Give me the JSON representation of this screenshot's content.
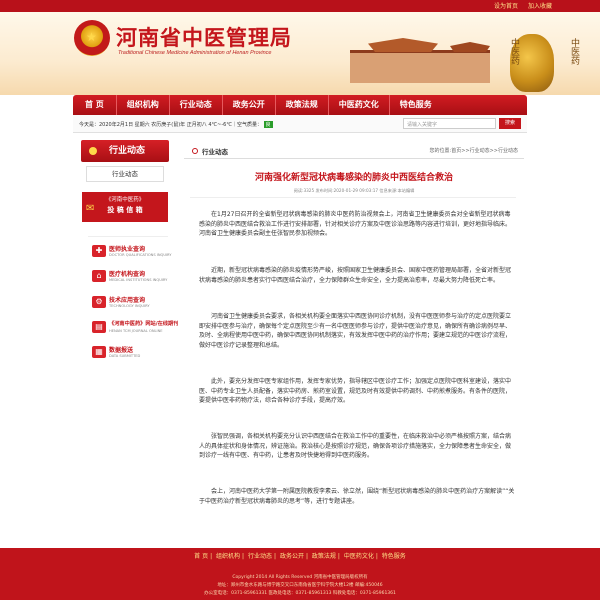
{
  "top_links": [
    "设为首页",
    "加入收藏"
  ],
  "header": {
    "title": "河南省中医管理局",
    "subtitle": "Traditional Chinese Medicine Administration of Henan Province",
    "calligraphy_left": "中医药",
    "calligraphy_right": "中医药"
  },
  "nav": [
    "首 页",
    "组织机构",
    "行业动态",
    "政务公开",
    "政策法规",
    "中医药文化",
    "特色服务"
  ],
  "infobar": {
    "date": "今天是：2020年2月1日 星期六 农历庚子(鼠)年 正月初八",
    "weather": "4℃~-6℃｜空气质量：",
    "aqi": "良",
    "search_placeholder": "请输入关键字",
    "search_button": "搜索"
  },
  "sidebar": {
    "heading": "行业动态",
    "current": "行业动态",
    "banner_top": "《河南中医药》",
    "banner_main": "投 稿 信 箱",
    "services": [
      {
        "title": "医师执业查询",
        "en": "DOCTOR QUALIFICATIONS INQUIRY",
        "icon": "doctor-icon"
      },
      {
        "title": "医疗机构查询",
        "en": "MEDICAL INSTITUTIONS INQUIRY",
        "icon": "hospital-icon"
      },
      {
        "title": "技术应用查询",
        "en": "TECHNOLOGY INQUIRY",
        "icon": "technology-icon"
      },
      {
        "title": "《河南中医药》网站/在线期刊",
        "en": "HENAN TCM JOURNAL ONLINE",
        "icon": "journal-icon"
      },
      {
        "title": "数据报送",
        "en": "DATA SUBMITTED",
        "icon": "data-icon"
      }
    ]
  },
  "main": {
    "section": "行业动态",
    "breadcrumb": "您的位置:首页>>行业动态>>行业动态",
    "title": "河南强化新型冠状病毒感染的肺炎中西医结合救治",
    "meta": "阅读:3325  发布时间:2020-01-29 09:03:17  信息来源:本站编辑",
    "paragraphs": [
      "在1月27日召开的全省新型冠状病毒感染的肺炎中医药防治视频会上，河南省卫生健康委员会对全省新型冠状病毒感染的肺炎中西医结合救治工作进行安排部署，针对相关诊疗方案及中医诊治思路等内容进行培训，更好地指导临床。河南省卫生健康委员会副主任张智民参加视频会。",
      "近期，新型冠状病毒感染的肺炎疫情形势严峻，按照国家卫生健康委员会、国家中医药管理局部署，全省对新型冠状病毒感染的肺炎患者实行中西医结合治疗，全力保障群众生命安全，全力提高治愈率，尽最大努力降低死亡率。",
      "河南省卫生健康委员会要求，各相关机构要全面落实中西医协同诊疗机制，没有中医医师参与治疗的定点医院要立即安排中医参与治疗，确保每个定点医院至少有一名中医医师参与诊疗，提供中医治疗意见，确保所有确诊病例尽早、及时、全病程使用中医中药，确保中西医协同机制落实，有效发挥中医中药的治疗作用；要建立规范的中医诊疗流程，做好中医诊疗记录整理和总结。",
      "此外，要充分发挥中医专家组作用，发挥专家优势，指导辖区中医诊疗工作；加强定点医院中医科室建设，落实中医、中药专业卫生人员配备，落实中药房、煎药室设置，规范及时有效提供中药调剂、中药煎煮服务。有条件的医院，要提供中医非药物疗法，综合各种诊疗手段，提高疗效。",
      "张智民强调，各相关机构要充分认识中西医结合在救治工作中的重要性，在临床救治中必须严格按照方案，结合病人的具体症状和身体情况，辨证施治。救治核心是按照诊疗规范，确保各项诊疗措施落实，全力保障患者生命安全，做到诊疗一线有中医、有中药，让患者及时快捷地得到中医药服务。",
      "会上，河南中医药大学第一附属医院教授李素云、徐立然，围绕“新型冠状病毒感染的肺炎中医药治疗方案解读”“关于中医药治疗新型冠状病毒肺炎的思考”等，进行专题讲座。"
    ]
  },
  "footer": {
    "links": [
      "首 页",
      "组织机构",
      "行业动态",
      "政务公开",
      "政策法规",
      "中医药文化",
      "特色服务"
    ],
    "copyright": "Copyright 2014 All Rights Reserved 河南省中医管理局版权所有",
    "address": "地址：郑州市金水东路与博学路交叉口东南角省医学科学院大楼12楼  邮编:450046",
    "phones": "办公室电话：0371-85961331    医政处电话：0371-85961313    科教处电话：0371-85961361"
  }
}
